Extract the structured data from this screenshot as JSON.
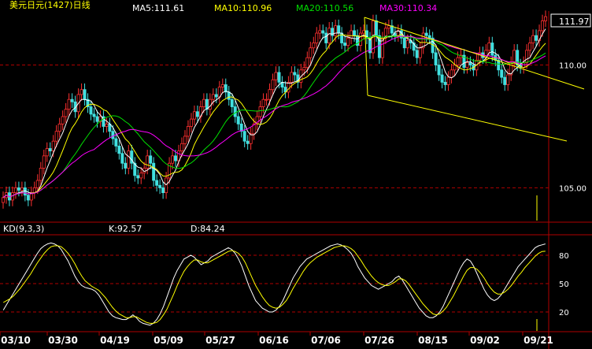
{
  "header": {
    "title": "美元日元(1427)日线",
    "ma5_label": "MA5:111.61",
    "ma10_label": "MA10:110.96",
    "ma20_label": "MA20:110.56",
    "ma30_label": "MA30:110.34"
  },
  "kd_header": {
    "name": "KD(9,3,3)",
    "k_label": "K:92.57",
    "d_label": "D:84.24"
  },
  "colors": {
    "background": "#000000",
    "up_candle": "#ff3030",
    "down_candle": "#40e0e0",
    "ma5": "#ffffff",
    "ma10": "#ffff00",
    "ma20": "#00e000",
    "ma30": "#ff00ff",
    "trend_channel": "#ffff00",
    "grid": "#b00000",
    "axis_text": "#ffffff"
  },
  "chart_data": [
    {
      "type": "candlestick",
      "title": "美元日元(1427)日线",
      "ylim": [
        103.6,
        112.2
      ],
      "y_ticks": [
        105.0,
        110.0
      ],
      "last_price_label": "111.97",
      "x_tick_labels": [
        "03/10",
        "03/30",
        "04/19",
        "05/09",
        "05/27",
        "06/16",
        "07/06",
        "07/26",
        "08/15",
        "09/02",
        "09/21"
      ],
      "closes": [
        104.6,
        104.8,
        104.5,
        104.8,
        105.0,
        104.9,
        105.0,
        104.7,
        104.5,
        104.8,
        105.0,
        105.3,
        105.8,
        106.3,
        106.6,
        106.5,
        106.9,
        107.3,
        107.6,
        107.9,
        108.2,
        108.6,
        108.5,
        108.1,
        108.8,
        109.0,
        108.6,
        108.3,
        108.0,
        107.9,
        107.7,
        107.9,
        107.5,
        107.6,
        107.3,
        107.0,
        106.7,
        106.4,
        106.0,
        105.8,
        106.5,
        106.0,
        105.5,
        105.4,
        105.6,
        105.8,
        106.3,
        106.0,
        105.3,
        105.1,
        105.0,
        104.8,
        105.4,
        106.0,
        106.3,
        106.1,
        106.5,
        106.8,
        107.1,
        107.5,
        107.8,
        108.1,
        107.9,
        108.3,
        108.6,
        108.2,
        108.6,
        108.8,
        108.7,
        109.1,
        109.2,
        108.9,
        108.6,
        108.3,
        107.9,
        107.6,
        107.3,
        106.9,
        106.8,
        107.2,
        107.6,
        107.9,
        108.3,
        108.6,
        108.6,
        109.0,
        109.4,
        109.7,
        109.3,
        109.1,
        108.9,
        109.3,
        109.7,
        109.6,
        109.3,
        109.8,
        109.9,
        110.3,
        110.7,
        110.9,
        111.3,
        111.4,
        111.3,
        110.9,
        111.5,
        111.2,
        111.6,
        111.3,
        110.9,
        110.8,
        111.1,
        111.4,
        111.2,
        110.8,
        111.3,
        111.4,
        111.1,
        110.5,
        111.8,
        111.2,
        110.3,
        111.1,
        111.5,
        111.6,
        111.3,
        111.2,
        111.4,
        111.1,
        110.7,
        111.0,
        110.9,
        110.6,
        110.3,
        110.7,
        111.3,
        111.2,
        111.1,
        110.5,
        110.0,
        109.6,
        109.3,
        109.2,
        109.5,
        109.8,
        110.0,
        110.3,
        110.4,
        109.9,
        110.1,
        110.0,
        109.8,
        110.2,
        110.5,
        110.3,
        110.6,
        110.9,
        110.4,
        110.2,
        109.8,
        109.5,
        109.2,
        109.6,
        110.1,
        110.6,
        110.0,
        109.9,
        110.1,
        110.6,
        110.9,
        111.2,
        111.0,
        111.4,
        111.8,
        111.97
      ]
    },
    {
      "type": "line",
      "title": "KD(9,3,3)",
      "ylim": [
        0,
        100
      ],
      "y_ticks": [
        20,
        50,
        80
      ],
      "series": [
        {
          "name": "K",
          "values": [
            22,
            28,
            34,
            40,
            46,
            52,
            58,
            64,
            70,
            76,
            82,
            87,
            90,
            92,
            93,
            92,
            90,
            86,
            80,
            74,
            66,
            58,
            52,
            48,
            46,
            45,
            44,
            42,
            38,
            32,
            26,
            20,
            16,
            14,
            13,
            12,
            12,
            14,
            17,
            14,
            10,
            8,
            7,
            6,
            8,
            12,
            18,
            26,
            36,
            46,
            56,
            64,
            70,
            76,
            78,
            80,
            78,
            74,
            70,
            72,
            74,
            78,
            80,
            82,
            84,
            86,
            88,
            86,
            82,
            76,
            68,
            58,
            48,
            40,
            32,
            28,
            24,
            22,
            20,
            20,
            22,
            26,
            32,
            40,
            48,
            56,
            62,
            68,
            72,
            76,
            78,
            80,
            82,
            84,
            86,
            88,
            90,
            91,
            92,
            91,
            89,
            86,
            82,
            76,
            68,
            62,
            56,
            52,
            48,
            46,
            44,
            46,
            48,
            50,
            52,
            56,
            58,
            54,
            48,
            42,
            36,
            30,
            24,
            20,
            16,
            14,
            14,
            16,
            20,
            26,
            34,
            42,
            50,
            58,
            66,
            72,
            76,
            74,
            68,
            60,
            52,
            44,
            38,
            34,
            32,
            34,
            38,
            44,
            50,
            56,
            62,
            68,
            72,
            76,
            80,
            84,
            88,
            90,
            91,
            92
          ]
        },
        {
          "name": "D",
          "values": [
            30,
            32,
            34,
            37,
            41,
            45,
            50,
            55,
            60,
            66,
            72,
            77,
            82,
            86,
            89,
            90,
            90,
            89,
            86,
            82,
            77,
            71,
            64,
            58,
            53,
            50,
            47,
            45,
            43,
            39,
            35,
            30,
            25,
            21,
            18,
            16,
            14,
            14,
            15,
            15,
            13,
            11,
            9,
            8,
            8,
            9,
            12,
            17,
            23,
            31,
            39,
            48,
            56,
            63,
            68,
            72,
            75,
            75,
            73,
            72,
            72,
            74,
            76,
            78,
            80,
            82,
            84,
            85,
            84,
            82,
            78,
            72,
            64,
            56,
            48,
            42,
            36,
            31,
            27,
            25,
            24,
            25,
            28,
            32,
            38,
            45,
            51,
            57,
            63,
            68,
            72,
            75,
            78,
            80,
            82,
            84,
            86,
            88,
            89,
            90,
            90,
            89,
            87,
            84,
            79,
            74,
            68,
            63,
            58,
            54,
            51,
            49,
            48,
            48,
            50,
            52,
            55,
            55,
            53,
            49,
            44,
            39,
            34,
            29,
            25,
            21,
            18,
            17,
            18,
            21,
            25,
            31,
            37,
            44,
            51,
            58,
            64,
            67,
            67,
            65,
            61,
            56,
            50,
            45,
            41,
            39,
            39,
            41,
            44,
            48,
            53,
            58,
            62,
            67,
            71,
            75,
            79,
            82,
            84,
            84.24
          ]
        }
      ]
    }
  ]
}
